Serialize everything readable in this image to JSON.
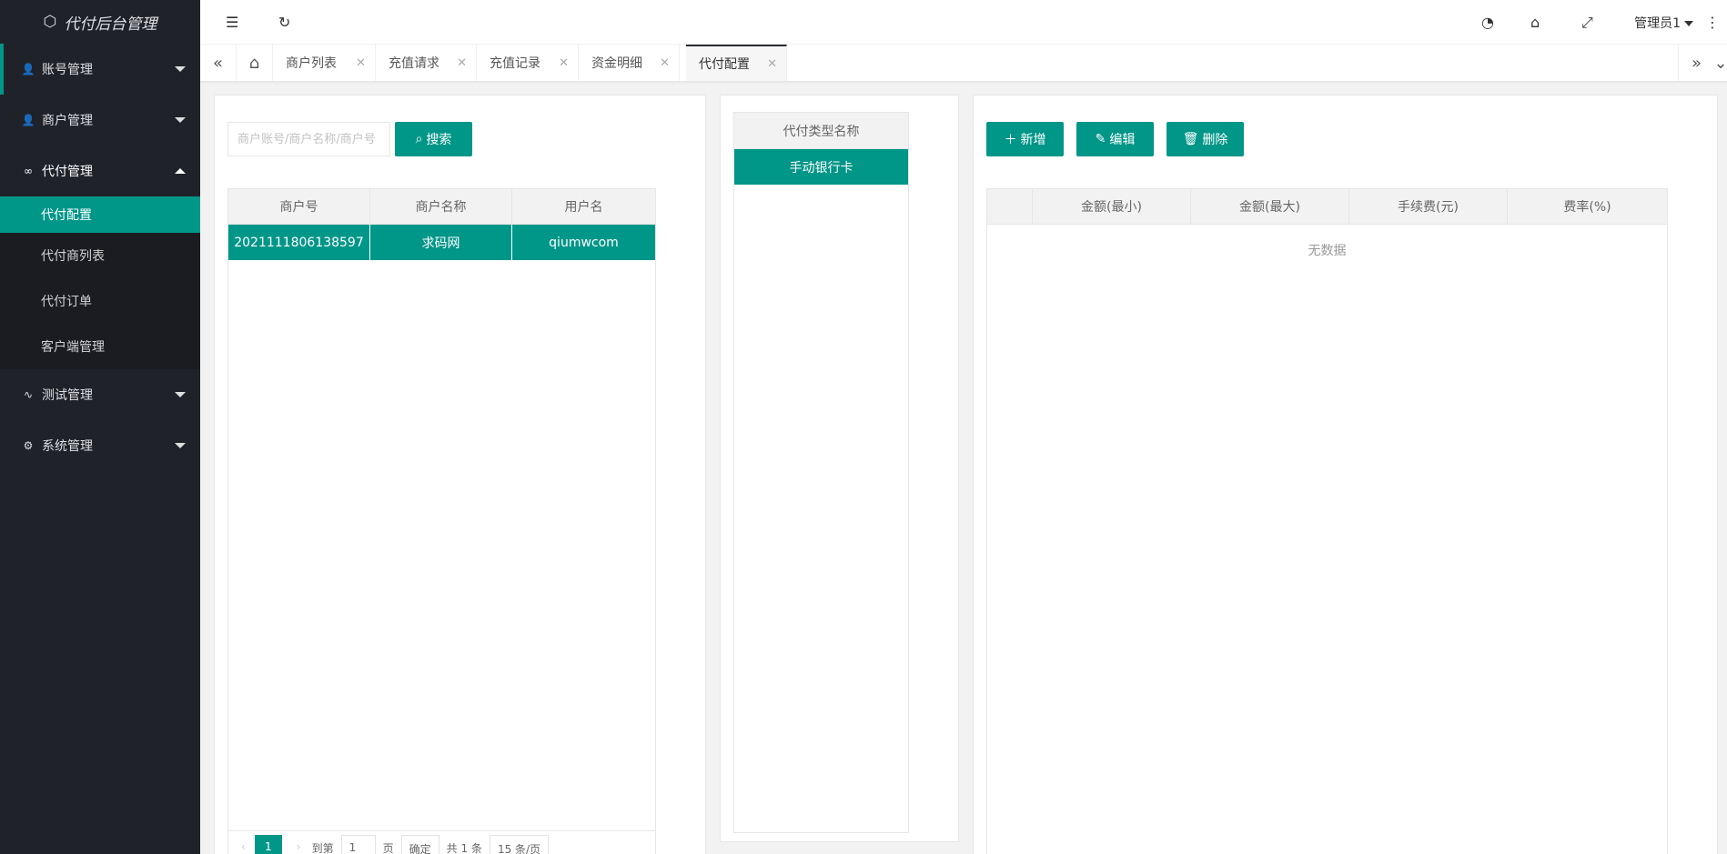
{
  "app": {
    "title": "代付后台管理",
    "logo_icon": "cube-icon"
  },
  "sidebar": {
    "items": [
      {
        "label": "账号管理",
        "icon": "user-icon"
      },
      {
        "label": "商户管理",
        "icon": "user-icon"
      },
      {
        "label": "代付管理",
        "icon": "link-icon"
      },
      {
        "label": "测试管理",
        "icon": "pulse-icon"
      },
      {
        "label": "系统管理",
        "icon": "gear-icon"
      }
    ],
    "sub_items": [
      "代付配置",
      "代付商列表",
      "代付订单",
      "客户端管理"
    ]
  },
  "header": {
    "user": "管理员1"
  },
  "tabs": [
    "商户列表",
    "充值请求",
    "充值记录",
    "资金明细",
    "代付配置"
  ],
  "left_panel": {
    "search_placeholder": "商户账号/商户名称/商户号",
    "search_button": "搜索",
    "columns": [
      "商户号",
      "商户名称",
      "用户名"
    ],
    "rows": [
      {
        "merchant_no": "2021111806138597",
        "merchant_name": "求码网",
        "username": "qiumwcom"
      }
    ],
    "pager": {
      "current": "1",
      "goto_prefix": "到第",
      "goto_value": "1",
      "goto_suffix": "页",
      "confirm": "确定",
      "total": "共 1 条",
      "per_page": "15 条/页"
    }
  },
  "middle_panel": {
    "header": "代付类型名称",
    "items": [
      "手动银行卡"
    ]
  },
  "right_panel": {
    "buttons": {
      "add": "新增",
      "edit": "编辑",
      "delete": "删除"
    },
    "columns": [
      "金额(最小)",
      "金额(最大)",
      "手续费(元)",
      "费率(%)"
    ],
    "empty_text": "无数据"
  },
  "colors": {
    "accent": "#009688",
    "sidebar_bg": "#20222a"
  }
}
